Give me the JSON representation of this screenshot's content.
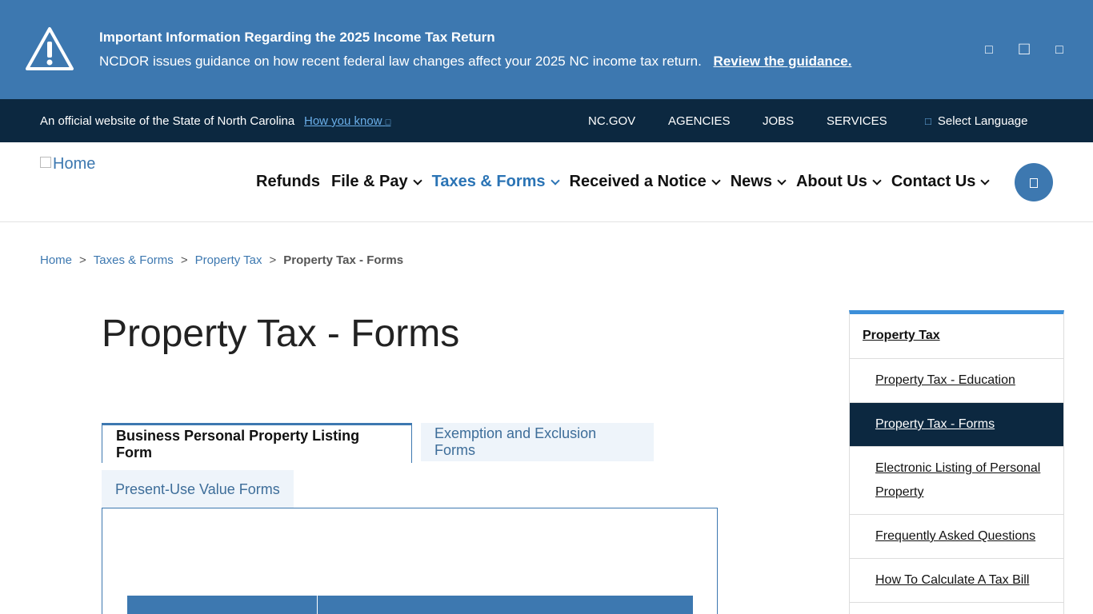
{
  "alert": {
    "title": "Important Information Regarding the 2025 Income Tax Return",
    "body": "NCDOR issues guidance on how recent federal law changes affect your 2025 NC income tax return.",
    "link": "Review the guidance.",
    "icon": "warning-triangle-icon"
  },
  "official_bar": {
    "text": "An official website of the State of North Carolina",
    "how_link": "How you know",
    "links": [
      "NC.GOV",
      "AGENCIES",
      "JOBS",
      "SERVICES"
    ],
    "language": "Select Language"
  },
  "header": {
    "logo_alt": "Home",
    "nav": [
      {
        "label": "Refunds",
        "has_menu": false
      },
      {
        "label": "File & Pay",
        "has_menu": true
      },
      {
        "label": "Taxes & Forms",
        "has_menu": true,
        "active": true
      },
      {
        "label": "Received a Notice",
        "has_menu": true
      },
      {
        "label": "News",
        "has_menu": true
      },
      {
        "label": "About Us",
        "has_menu": true
      },
      {
        "label": "Contact Us",
        "has_menu": true
      }
    ]
  },
  "breadcrumb": {
    "items": [
      "Home",
      "Taxes & Forms",
      "Property Tax"
    ],
    "separator": ">",
    "current": "Property Tax - Forms"
  },
  "page": {
    "title": "Property Tax - Forms"
  },
  "tabs": [
    {
      "label": "Business Personal Property Listing Form",
      "active": true
    },
    {
      "label": "Exemption and Exclusion Forms",
      "active": false
    },
    {
      "label": "Present-Use Value Forms",
      "active": false
    }
  ],
  "sidebar": {
    "heading": "Property Tax",
    "items": [
      {
        "label": "Property Tax - Education",
        "active": false
      },
      {
        "label": "Property Tax - Forms",
        "active": true
      },
      {
        "label": "Electronic Listing of Personal Property",
        "active": false
      },
      {
        "label": "Frequently Asked Questions",
        "active": false
      },
      {
        "label": "How To Calculate A Tax Bill",
        "active": false
      }
    ]
  },
  "colors": {
    "alert_bg": "#3d78b0",
    "dark_bar": "#0c2840",
    "link_blue": "#3d78b0",
    "active_nav": "#2b74b5"
  }
}
